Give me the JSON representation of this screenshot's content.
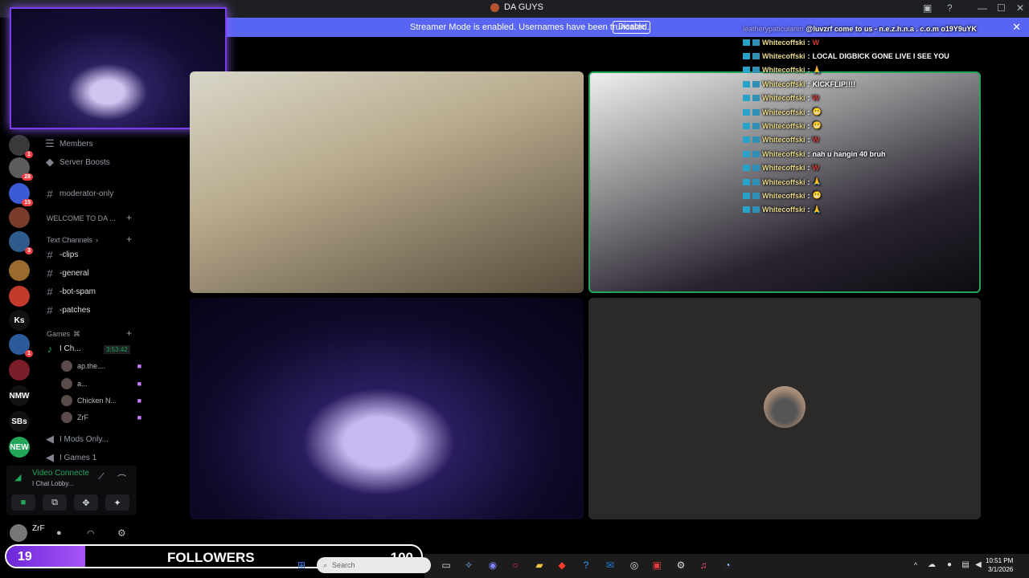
{
  "window": {
    "title": "DA GUYS",
    "controls": [
      "▣",
      "?",
      "—",
      "☐",
      "✕"
    ]
  },
  "banner": {
    "text": "Streamer Mode is enabled. Usernames have been truncated.",
    "disable_label": "Disable",
    "close": "✕"
  },
  "servers": [
    {
      "label": "",
      "color": "#3a3a3a",
      "badge": "1"
    },
    {
      "label": "",
      "color": "#5c5c5c",
      "badge": "28"
    },
    {
      "label": "",
      "color": "#3b5bd6",
      "badge": "15"
    },
    {
      "label": "",
      "color": "#7a3c2a",
      "badge": ""
    },
    {
      "label": "",
      "color": "#2f5a8c",
      "badge": "3"
    },
    {
      "label": "",
      "color": "#9a6b2f",
      "badge": ""
    },
    {
      "label": "",
      "color": "#c23a2a",
      "badge": ""
    },
    {
      "label": "Ks",
      "color": "#111",
      "badge": ""
    },
    {
      "label": "",
      "color": "#2a5a9a",
      "badge": "1"
    },
    {
      "label": "",
      "color": "#7a1f2a",
      "badge": ""
    },
    {
      "label": "NMW",
      "color": "#111",
      "badge": ""
    },
    {
      "label": "SBs",
      "color": "#111",
      "badge": ""
    },
    {
      "label": "NEW",
      "color": "#23a55a",
      "badge": ""
    }
  ],
  "sidebar": {
    "members": "Members",
    "boosts": "Server Boosts",
    "moderator": "moderator-only",
    "welcome_category": "WELCOME TO DA ...",
    "text_category": "Text Channels",
    "channels": [
      "-clips",
      "-general",
      "-bot-spam",
      "-patches"
    ],
    "games_category": "Games",
    "voice_channel": "I Ch...",
    "timer": "3:53:42",
    "voice_users": [
      "ap.the....",
      "a...",
      "Chicken N...",
      "ZrF"
    ],
    "mods_channel": "I Mods Only...",
    "games_channel": "I Games 1"
  },
  "voice_panel": {
    "title": "Video Connecte",
    "subtitle": "I Chat Lobby...",
    "buttons": [
      "■",
      "⧉",
      "✥",
      "✦"
    ]
  },
  "user": {
    "name": "ZrF"
  },
  "chat": {
    "top_user": "leatherypaticularim",
    "top_text": "@luvzrf come to us - n.e.z.h.n.a . c.o.m o19Y9uYK",
    "messages": [
      {
        "user": "Whitecoffski",
        "text": "W"
      },
      {
        "user": "Whitecoffski",
        "text": "LOCAL DIGBICK GONE LIVE I SEE YOU"
      },
      {
        "user": "Whitecoffski",
        "text": "🙏"
      },
      {
        "user": "Whitecoffski",
        "text": "KICKFLIP!!!!"
      },
      {
        "user": "Whitecoffski",
        "text": "W"
      },
      {
        "user": "Whitecoffski",
        "text": "😬"
      },
      {
        "user": "Whitecoffski",
        "text": "😬"
      },
      {
        "user": "Whitecoffski",
        "text": "W"
      },
      {
        "user": "Whitecoffski",
        "text": "nah u hangin 40 bruh"
      },
      {
        "user": "Whitecoffski",
        "text": "W"
      },
      {
        "user": "Whitecoffski",
        "text": "🙏"
      },
      {
        "user": "Whitecoffski",
        "text": "😬"
      },
      {
        "user": "Whitecoffski",
        "text": "🙏"
      }
    ]
  },
  "followers": {
    "count": "19",
    "label": "FOLLOWERS",
    "goal": "100",
    "progress": 0.19
  },
  "taskbar": {
    "search_placeholder": "Search",
    "time": "10:51 PM",
    "date": "3/1/2026"
  }
}
